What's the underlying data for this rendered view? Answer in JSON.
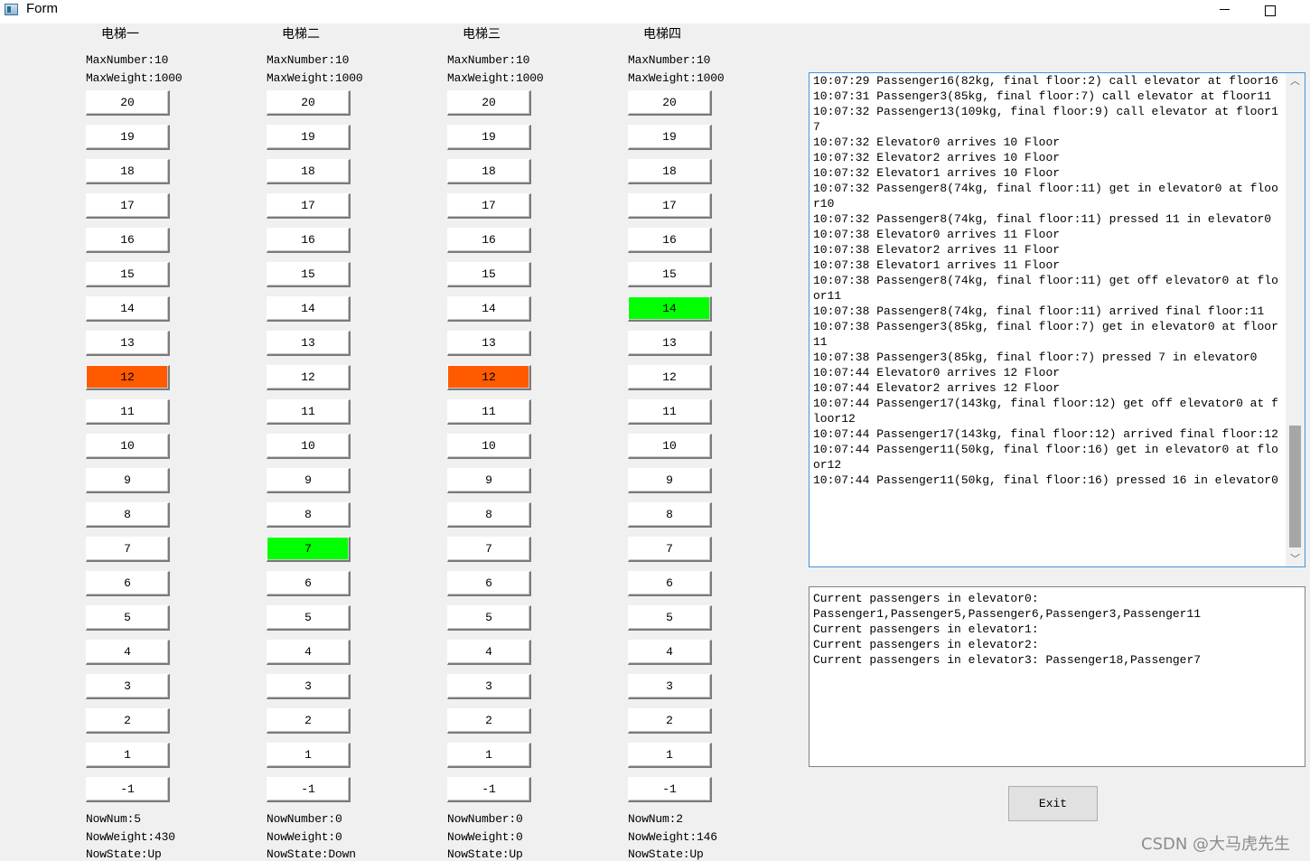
{
  "window": {
    "title": "Form",
    "minimize_glyph": "—",
    "maximize_glyph": "☐"
  },
  "elevators": [
    {
      "name": "电梯一",
      "max_number": "MaxNumber:10",
      "max_weight": "MaxWeight:1000",
      "now_num": "NowNum:5",
      "now_weight": "NowWeight:430",
      "now_state": "NowState:Up",
      "lit_floors": {
        "12": "#ff5a00"
      }
    },
    {
      "name": "电梯二",
      "max_number": "MaxNumber:10",
      "max_weight": "MaxWeight:1000",
      "now_num": "NowNumber:0",
      "now_weight": "NowWeight:0",
      "now_state": "NowState:Down",
      "lit_floors": {
        "7": "#00ff00"
      }
    },
    {
      "name": "电梯三",
      "max_number": "MaxNumber:10",
      "max_weight": "MaxWeight:1000",
      "now_num": "NowNumber:0",
      "now_weight": "NowWeight:0",
      "now_state": "NowState:Up",
      "lit_floors": {
        "12": "#ff5a00"
      }
    },
    {
      "name": "电梯四",
      "max_number": "MaxNumber:10",
      "max_weight": "MaxWeight:1000",
      "now_num": "NowNum:2",
      "now_weight": "NowWeight:146",
      "now_state": "NowState:Up",
      "lit_floors": {
        "14": "#00ff00"
      }
    }
  ],
  "floors": [
    "20",
    "19",
    "18",
    "17",
    "16",
    "15",
    "14",
    "13",
    "12",
    "11",
    "10",
    "9",
    "8",
    "7",
    "6",
    "5",
    "4",
    "3",
    "2",
    "1",
    "-1"
  ],
  "log": {
    "text": "10:07:29 Passenger16(82kg, final floor:2) call elevator at floor16\n10:07:31 Passenger3(85kg, final floor:7) call elevator at floor11\n10:07:32 Passenger13(109kg, final floor:9) call elevator at floor17\n10:07:32 Elevator0 arrives 10 Floor\n10:07:32 Elevator2 arrives 10 Floor\n10:07:32 Elevator1 arrives 10 Floor\n10:07:32 Passenger8(74kg, final floor:11) get in elevator0 at floor10\n10:07:32 Passenger8(74kg, final floor:11) pressed 11 in elevator0\n10:07:38 Elevator0 arrives 11 Floor\n10:07:38 Elevator2 arrives 11 Floor\n10:07:38 Elevator1 arrives 11 Floor\n10:07:38 Passenger8(74kg, final floor:11) get off elevator0 at floor11\n10:07:38 Passenger8(74kg, final floor:11) arrived final floor:11\n10:07:38 Passenger3(85kg, final floor:7) get in elevator0 at floor11\n10:07:38 Passenger3(85kg, final floor:7) pressed 7 in elevator0\n10:07:44 Elevator0 arrives 12 Floor\n10:07:44 Elevator2 arrives 12 Floor\n10:07:44 Passenger17(143kg, final floor:12) get off elevator0 at floor12\n10:07:44 Passenger17(143kg, final floor:12) arrived final floor:12\n10:07:44 Passenger11(50kg, final floor:16) get in elevator0 at floor12\n10:07:44 Passenger11(50kg, final floor:16) pressed 16 in elevator0",
    "scroll_up": "︿",
    "scroll_down": "﹀",
    "scroll_position": 0.9
  },
  "passengers": {
    "text": "Current passengers in elevator0:\nPassenger1,Passenger5,Passenger6,Passenger3,Passenger11\nCurrent passengers in elevator1:\nCurrent passengers in elevator2:\nCurrent passengers in elevator3: Passenger18,Passenger7"
  },
  "exit_label": "Exit",
  "watermark": "CSDN @大马虎先生"
}
